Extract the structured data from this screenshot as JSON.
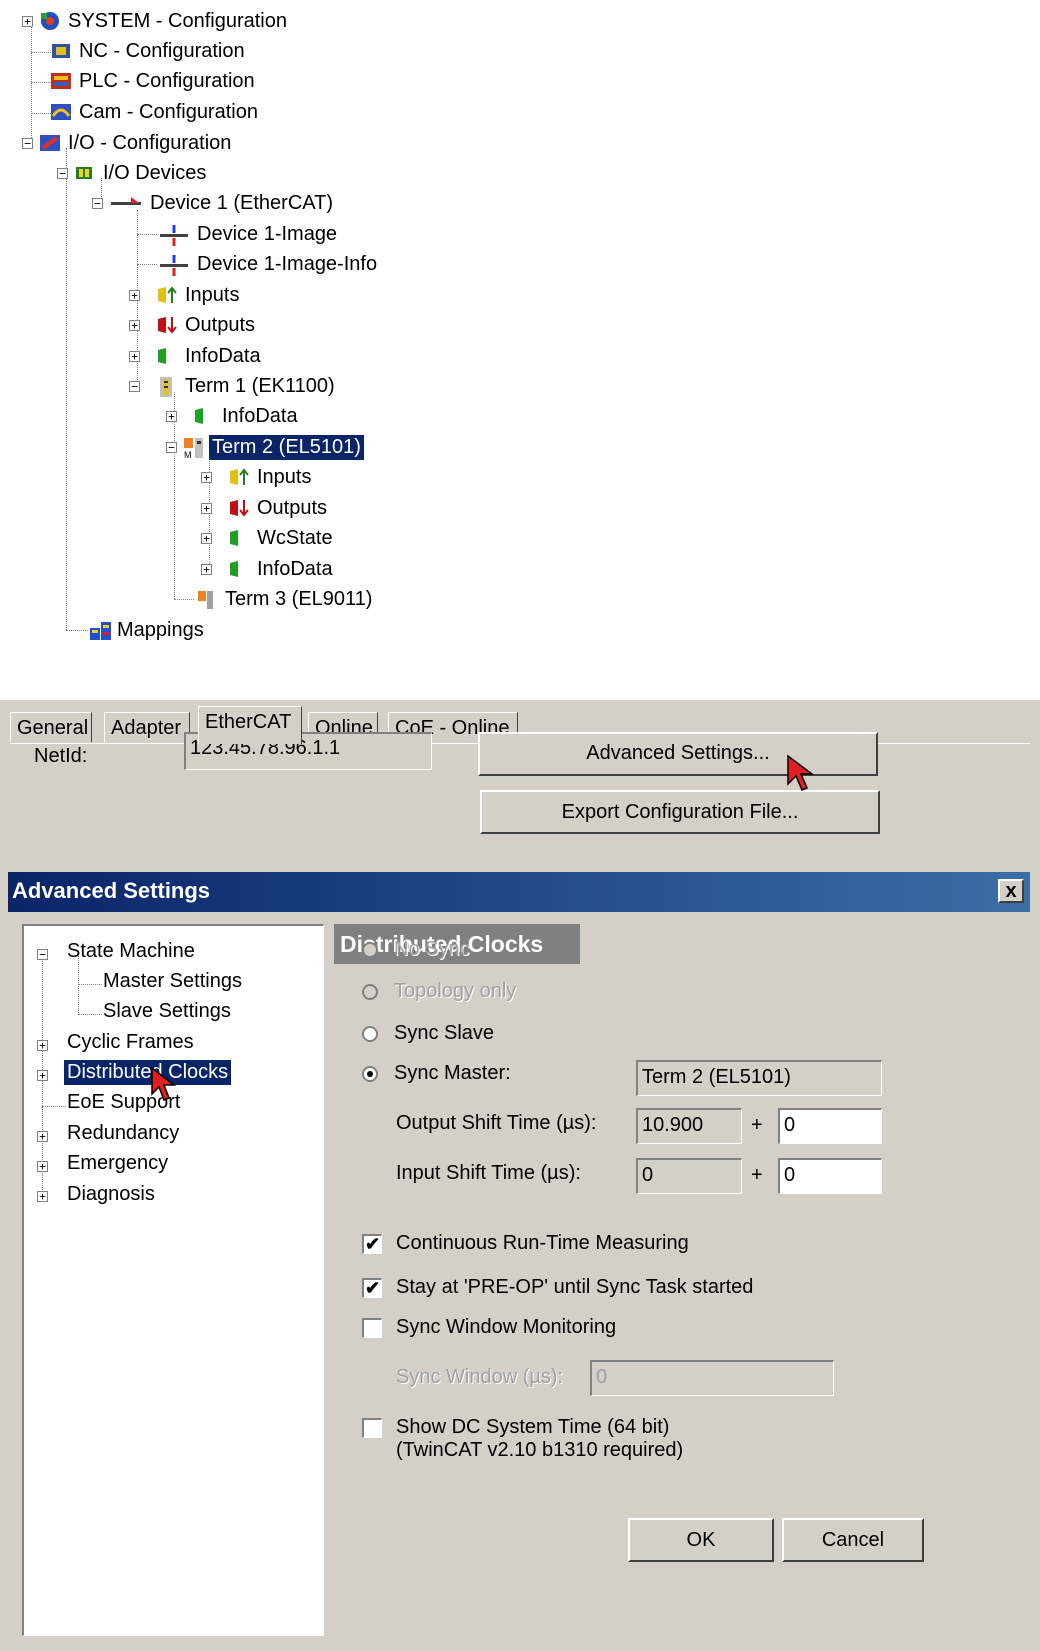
{
  "tree": {
    "nodes": [
      {
        "label": "SYSTEM - Configuration"
      },
      {
        "label": "NC - Configuration"
      },
      {
        "label": "PLC - Configuration"
      },
      {
        "label": "Cam - Configuration"
      },
      {
        "label": "I/O - Configuration"
      },
      {
        "label": "I/O Devices"
      },
      {
        "label": "Device 1 (EtherCAT)"
      },
      {
        "label": "Device 1-Image"
      },
      {
        "label": "Device 1-Image-Info"
      },
      {
        "label": "Inputs"
      },
      {
        "label": "Outputs"
      },
      {
        "label": "InfoData"
      },
      {
        "label": "Term 1 (EK1100)"
      },
      {
        "label": "InfoData"
      },
      {
        "label": "Term 2 (EL5101)"
      },
      {
        "label": "Inputs"
      },
      {
        "label": "Outputs"
      },
      {
        "label": "WcState"
      },
      {
        "label": "InfoData"
      },
      {
        "label": "Term 3 (EL9011)"
      },
      {
        "label": "Mappings"
      }
    ],
    "selected": "Term 2 (EL5101)"
  },
  "props": {
    "tabs": [
      "General",
      "Adapter",
      "EtherCAT",
      "Online",
      "CoE - Online"
    ],
    "active_tab": "EtherCAT",
    "netid_label": "NetId:",
    "netid_value": "123.45.78.96.1.1",
    "advanced_button": "Advanced Settings...",
    "export_button": "Export Configuration File..."
  },
  "dialog": {
    "title": "Advanced Settings",
    "close_label": "x",
    "tree": [
      {
        "label": "State Machine"
      },
      {
        "label": "Master Settings"
      },
      {
        "label": "Slave Settings"
      },
      {
        "label": "Cyclic Frames"
      },
      {
        "label": "Distributed Clocks"
      },
      {
        "label": "EoE Support"
      },
      {
        "label": "Redundancy"
      },
      {
        "label": "Emergency"
      },
      {
        "label": "Diagnosis"
      }
    ],
    "selected": "Distributed Clocks",
    "section_title": "Distributed Clocks",
    "radio_no_sync": "No Sync",
    "radio_topology": "Topology only",
    "radio_sync_slave": "Sync Slave",
    "radio_sync_master": "Sync Master:",
    "sync_master_value": "Term 2 (EL5101)",
    "output_shift_label": "Output Shift Time (µs):",
    "output_shift_value": "10.900",
    "output_shift_add": "0",
    "input_shift_label": "Input Shift Time (µs):",
    "input_shift_value": "0",
    "input_shift_add": "0",
    "plus": "+",
    "chk_continuous": "Continuous Run-Time Measuring",
    "chk_continuous_checked": true,
    "chk_preop": "Stay at 'PRE-OP' until Sync Task started",
    "chk_preop_checked": true,
    "chk_window": "Sync Window Monitoring",
    "chk_window_checked": false,
    "sync_window_label": "Sync Window (µs):",
    "sync_window_value": "0",
    "chk_dc_time_line1": "Show DC System Time (64 bit)",
    "chk_dc_time_line2": "(TwinCAT  v2.10 b1310 required)",
    "chk_dc_time_checked": false,
    "ok": "OK",
    "cancel": "Cancel",
    "expand_plus": "+",
    "expand_minus": "−",
    "check_mark": "✔"
  }
}
